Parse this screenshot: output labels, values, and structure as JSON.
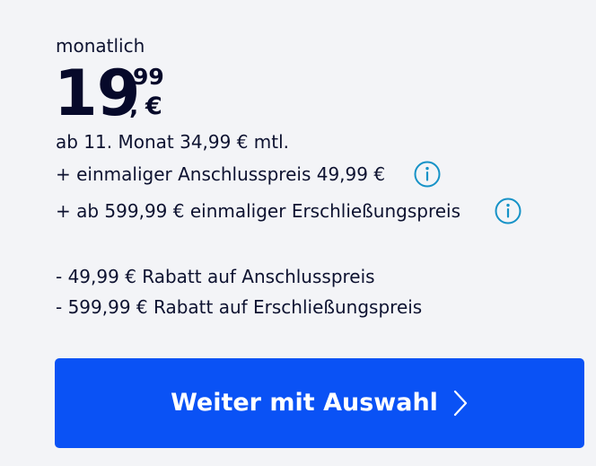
{
  "pricing": {
    "period_label": "monatlich",
    "price_integer": "19",
    "price_decimal_separator": ",",
    "price_cents": "99",
    "price_currency": "€",
    "after_month_note": "ab 11. Monat 34,99 € mtl.",
    "fee_connection": "+ einmaliger Anschlusspreis 49,99 €",
    "fee_development": "+ ab 599,99 € einmaliger Erschließungspreis",
    "discount_connection": "- 49,99 € Rabatt auf Anschlusspreis",
    "discount_development": "- 599,99 € Rabatt auf Erschließungspreis"
  },
  "icons": {
    "info": "info-icon",
    "chevron": "chevron-right-icon"
  },
  "cta": {
    "label": "Weiter mit Auswahl"
  },
  "colors": {
    "background": "#f3f4f7",
    "text": "#0d1230",
    "info_accent": "#1592c7",
    "button": "#0a52f5",
    "button_text": "#ffffff"
  }
}
